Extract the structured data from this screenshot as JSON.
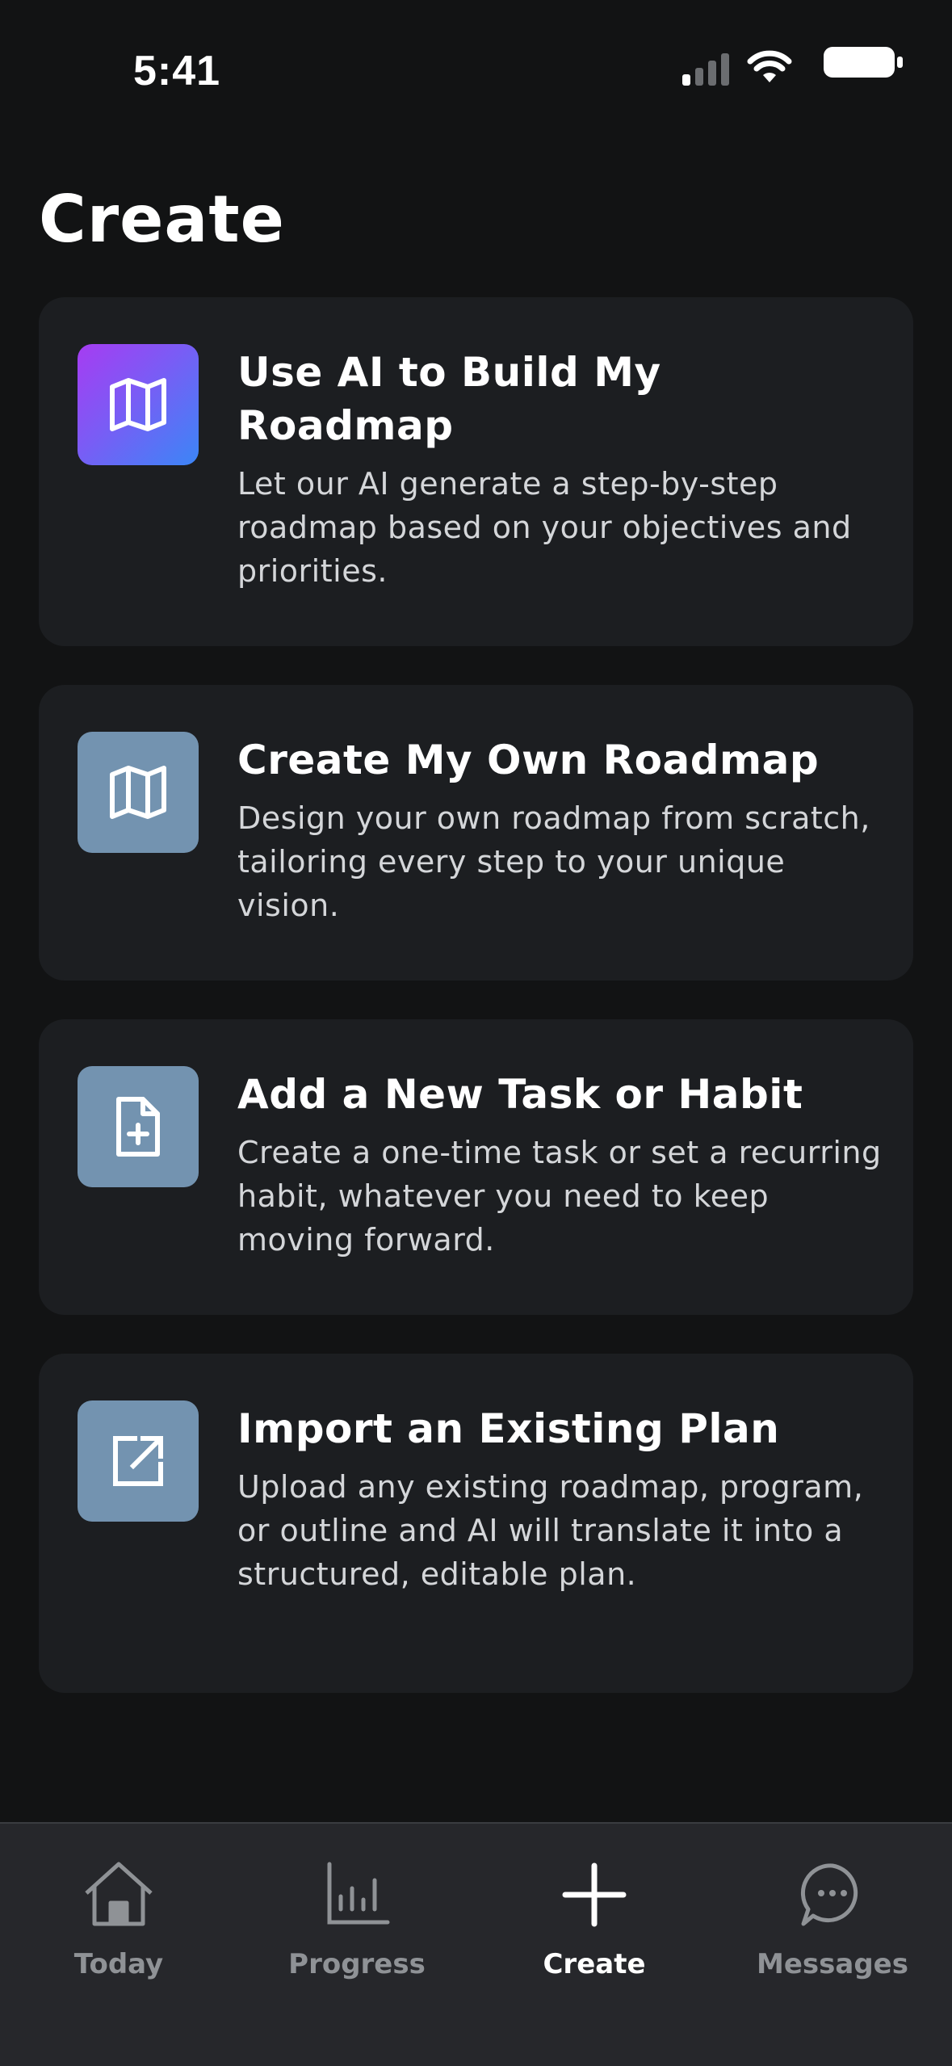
{
  "status_bar": {
    "time": "5:41",
    "signal_icon": "cellular-signal-icon",
    "wifi_icon": "wifi-icon",
    "battery_icon": "battery-icon"
  },
  "page": {
    "title": "Create"
  },
  "cards": [
    {
      "icon": "map-icon",
      "title": "Use AI to Build My Roadmap",
      "description": "Let our AI generate a step-by-step roadmap based on your objectives and priorities."
    },
    {
      "icon": "map-icon",
      "title": "Create My Own Roadmap",
      "description": "Design your own roadmap from scratch, tailoring every step to your unique vision."
    },
    {
      "icon": "document-plus-icon",
      "title": "Add a New Task or Habit",
      "description": "Create a one-time task or set a recurring habit, whatever you need to keep moving forward."
    },
    {
      "icon": "external-link-icon",
      "title": "Import an Existing Plan",
      "description": "Upload any existing roadmap, program, or outline and AI will translate it into a structured, editable plan."
    }
  ],
  "colors": {
    "background": "#121314",
    "card_background": "#1c1e21",
    "icon_tile": "#7393b0",
    "ai_gradient_start": "#a63cf2",
    "ai_gradient_end": "#3b86f6",
    "tab_bar": "#26272b",
    "tab_inactive": "#8f9296",
    "tab_active": "#ffffff"
  },
  "tab_bar": {
    "tabs": [
      {
        "label": "Today",
        "icon": "home-icon"
      },
      {
        "label": "Progress",
        "icon": "bar-chart-icon"
      },
      {
        "label": "Create",
        "icon": "plus-icon",
        "active": true
      },
      {
        "label": "Messages",
        "icon": "chat-bubble-icon"
      }
    ]
  }
}
